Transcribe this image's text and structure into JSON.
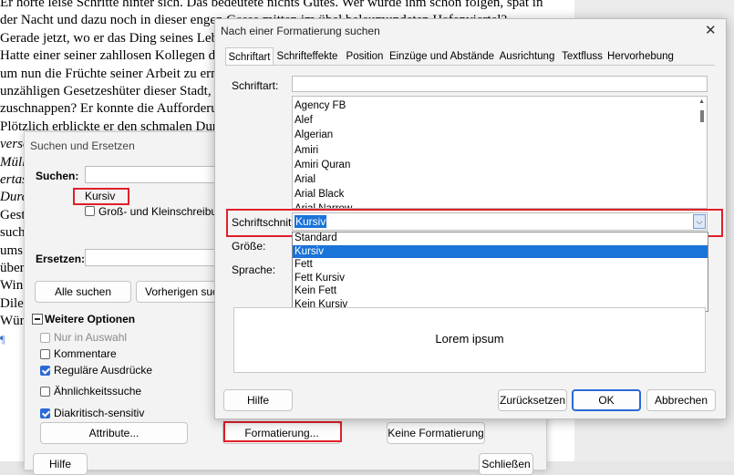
{
  "document": {
    "lines": [
      {
        "text": "Er hörte leise Schritte hinter sich. Das bedeutete nichts Gutes. Wer würde ihm schon folgen, spät in",
        "italic": false
      },
      {
        "text": "der Nacht und dazu noch in dieser engen Gasse mitten im übel beleumundeten Hafenviertel?",
        "italic": false
      },
      {
        "text": "Gerade jetzt, wo er das Ding seines Lebens gedreht hatte und mit der Beute verschwinden wollte!",
        "italic": false
      },
      {
        "text": "Hatte einer seiner zahllosen Kollegen dieselbe Idee gehabt, ihn beobachtet und abgewartet,",
        "italic": false
      },
      {
        "text": "um nun die Früchte seiner Arbeit zu ernten? Oder gehörten die Schritte hinter ihm zu einem der",
        "italic": false
      },
      {
        "text": "unzähligen Gesetzeshüter dieser Stadt, und die stählerne Acht um seine Handgelenke würde gleich",
        "italic": false
      },
      {
        "text": "zuschnappen? Er konnte die Aufforderung stehen zu bleiben schon fast hören.",
        "italic": false
      },
      {
        "text": "Plötzlich erblickte er den schmalen Durchgang.",
        "italic": false
      },
      {
        "text": "verschwand zwischen den beiden Gebäuden",
        "italic": true
      },
      {
        "text": "Müll",
        "italic": true
      },
      {
        "text": "ertas",
        "italic": true
      },
      {
        "text": "Durc",
        "italic": true
      },
      {
        "text": "Gest",
        "italic": false
      },
      {
        "text": "such",
        "italic": false
      },
      {
        "text": "ums",
        "italic": false
      },
      {
        "text": "über",
        "italic": false
      },
      {
        "text": "Win",
        "italic": false
      },
      {
        "text": "Dile",
        "italic": false
      },
      {
        "text": "Wür",
        "italic": false
      },
      {
        "text": "¶",
        "italic": false
      }
    ]
  },
  "search_replace": {
    "title": "Suchen und Ersetzen",
    "search_label": "Suchen:",
    "search_value": "",
    "attribute_hint": "Kursiv",
    "match_case_label": "Groß- und Kleinschreibung b",
    "replace_label": "Ersetzen:",
    "replace_value": "",
    "find_all": "Alle suchen",
    "find_prev": "Vorherigen suche",
    "more_options": "Weitere Optionen",
    "options": [
      {
        "label": "Nur in Auswahl",
        "checked": false,
        "disabled": true
      },
      {
        "label": "Kommentare",
        "checked": false,
        "disabled": false
      },
      {
        "label": "Reguläre Ausdrücke",
        "checked": true,
        "disabled": false
      },
      {
        "label": "Ähnlichkeitssuche",
        "checked": false,
        "disabled": false
      },
      {
        "label": "Diakritisch-sensitiv",
        "checked": true,
        "disabled": false
      }
    ],
    "attributes_btn": "Attribute...",
    "formatting_btn": "Formatierung...",
    "no_formatting_btn": "Keine Formatierung",
    "help_btn": "Hilfe",
    "close_btn": "Schließen"
  },
  "format_dialog": {
    "title": "Nach einer Formatierung suchen",
    "tabs": [
      "Schriftart",
      "Schrifteffekte",
      "Position",
      "Einzüge und Abstände",
      "Ausrichtung",
      "Textfluss",
      "Hervorhebung"
    ],
    "font_label": "Schriftart:",
    "font_value": "",
    "fonts": [
      "Agency FB",
      "Alef",
      "Algerian",
      "Amiri",
      "Amiri Quran",
      "Arial",
      "Arial Black",
      "Arial Narrow"
    ],
    "style_label": "Schriftschnitt:",
    "style_value": "Kursiv",
    "size_label": "Größe:",
    "language_label": "Sprache:",
    "style_options": [
      "Standard",
      "Kursiv",
      "Fett",
      "Fett Kursiv",
      "Kein Fett",
      "Kein Kursiv"
    ],
    "style_selected_index": 1,
    "preview_text": "Lorem ipsum",
    "help_btn": "Hilfe",
    "reset_btn": "Zurücksetzen",
    "ok_btn": "OK",
    "cancel_btn": "Abbrechen"
  },
  "colors": {
    "highlight": "#e0202a",
    "selection": "#1a73d9"
  }
}
